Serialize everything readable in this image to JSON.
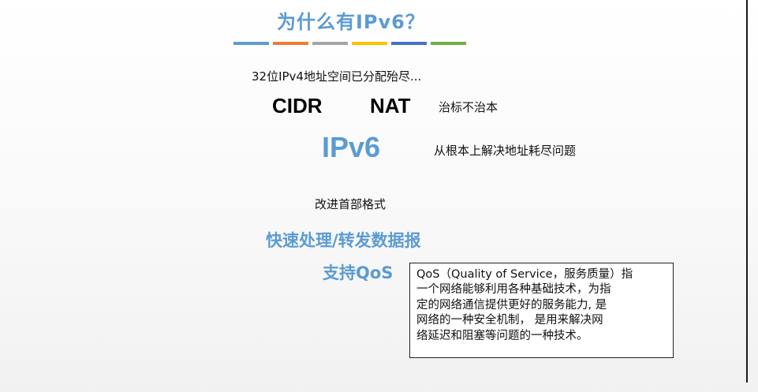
{
  "slide": {
    "title": "为什么有IPv6？",
    "color_bars": [
      "#5b9bd5",
      "#ed7d31",
      "#a5a5a5",
      "#ffc000",
      "#4472c4",
      "#70ad47"
    ],
    "line1": "32位IPv4地址空间已分配殆尽...",
    "cidr": "CIDR",
    "nat": "NAT",
    "cidr_nat_note": "治标不治本",
    "ipv6": "IPv6",
    "ipv6_note": "从根本上解决地址耗尽问题",
    "improve_header": "改进首部格式",
    "fast_forward": "快速处理/转发数据报",
    "support_qos": "支持QoS",
    "qos_box_lines": [
      "QoS（Quality of Service，服务质量）指",
      "一个网络能够利用各种基础技术，为指",
      "定的网络通信提供更好的服务能力, 是",
      "网络的一种安全机制， 是用来解决网",
      "络延迟和阻塞等问题的一种技术。"
    ]
  }
}
